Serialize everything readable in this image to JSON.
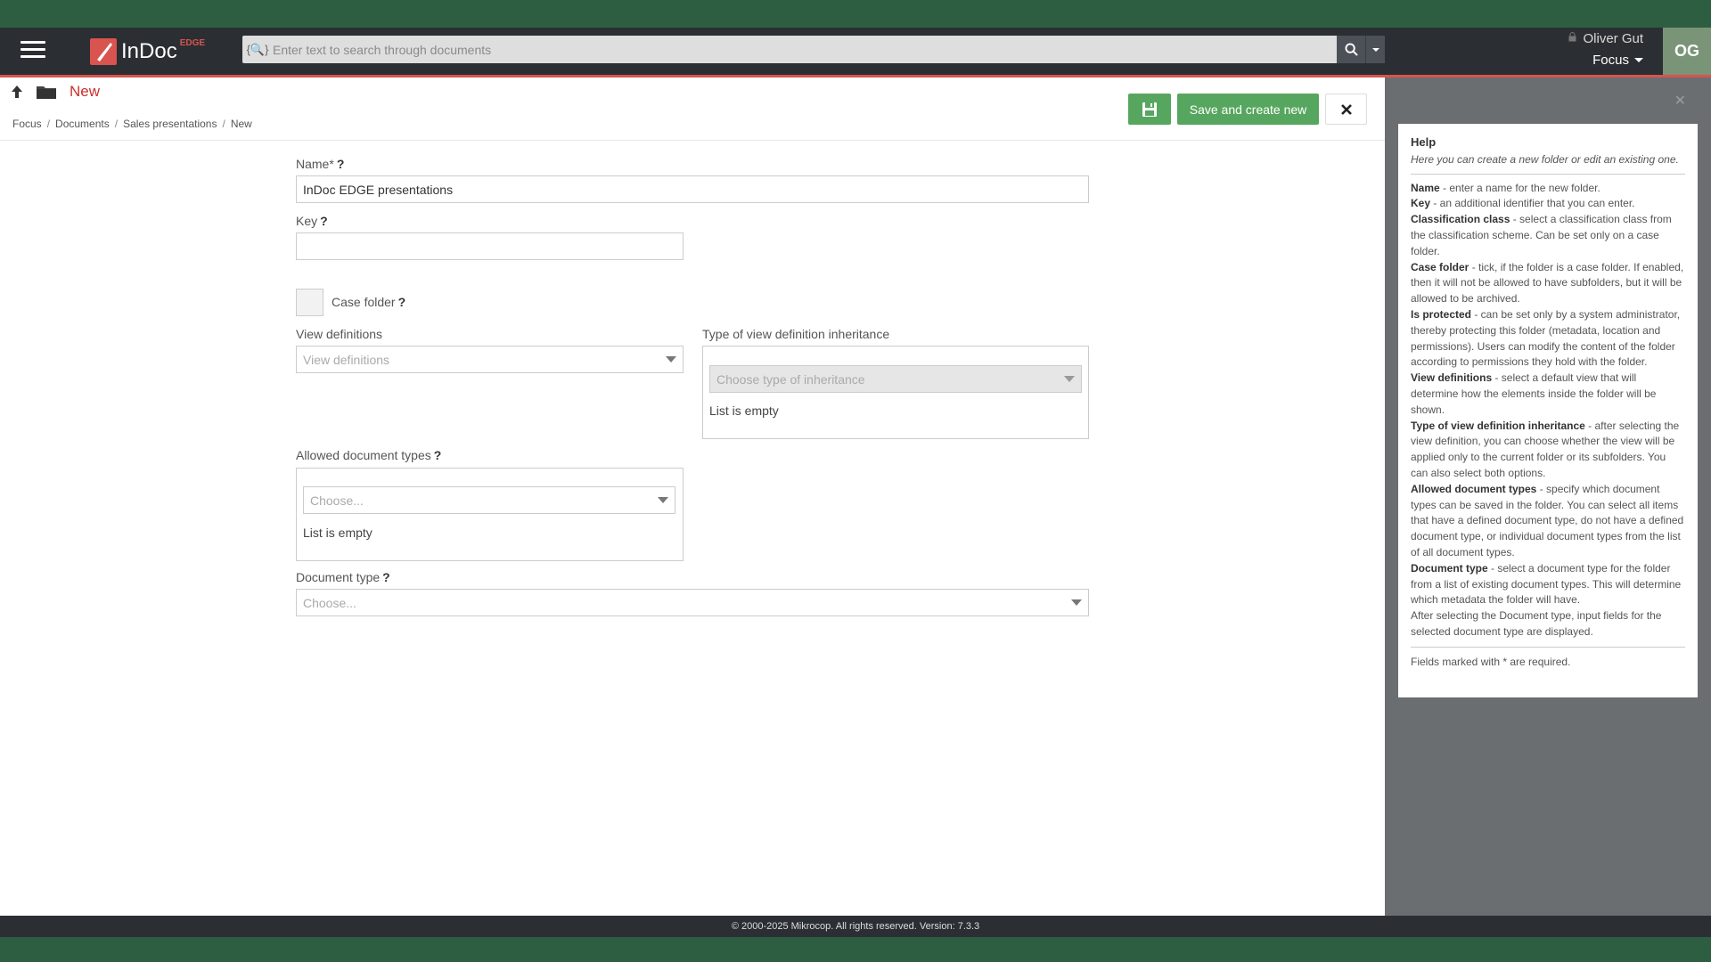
{
  "app": {
    "name": "InDoc",
    "edition": "EDGE"
  },
  "search": {
    "placeholder": "Enter text to search through documents"
  },
  "user": {
    "name": "Oliver Gut",
    "initials": "OG",
    "context": "Focus"
  },
  "page": {
    "title": "New"
  },
  "breadcrumb": [
    "Focus",
    "Documents",
    "Sales presentations",
    "New"
  ],
  "toolbar": {
    "save_new_label": "Save and create new"
  },
  "form": {
    "name_label": "Name",
    "name_required": "*",
    "name_value": "InDoc EDGE presentations",
    "key_label": "Key",
    "key_value": "",
    "case_folder_label": "Case folder",
    "view_definitions_label": "View definitions",
    "view_definitions_placeholder": "View definitions",
    "inheritance_label": "Type of view definition inheritance",
    "inheritance_placeholder": "Choose type of inheritance",
    "inheritance_empty": "List is empty",
    "allowed_types_label": "Allowed document types",
    "allowed_types_placeholder": "Choose...",
    "allowed_types_empty": "List is empty",
    "doc_type_label": "Document type",
    "doc_type_placeholder": "Choose...",
    "help_marker": "?"
  },
  "help": {
    "title": "Help",
    "intro": "Here you can create a new folder or edit an existing one.",
    "items": [
      {
        "term": "Name",
        "text": " - enter a name for the new folder."
      },
      {
        "term": "Key",
        "text": " - an additional identifier that you can enter."
      },
      {
        "term": "Classification class",
        "text": " - select a classification class from the classification scheme. Can be set only on a case folder."
      },
      {
        "term": "Case folder",
        "text": " - tick, if the folder is a case folder. If enabled, then it will not be allowed to have subfolders, but it will be allowed to be archived."
      },
      {
        "term": "Is protected",
        "text": " - can be set only by a system administrator, thereby protecting this folder (metadata, location and permissions). Users can modify the content of the folder according to permissions they hold with the folder."
      },
      {
        "term": "View definitions",
        "text": " - select a default view that will determine how the elements inside the folder will be shown."
      },
      {
        "term": "Type of view definition inheritance",
        "text": " - after selecting the view definition, you can choose whether the view will be applied only to the current folder or its subfolders. You can also select both options."
      },
      {
        "term": "Allowed document types",
        "text": " - specify which document types can be saved in the folder. You can select all items that have a defined document type, do not have a defined document type, or individual document types from the list of all document types."
      },
      {
        "term": "Document type",
        "text": " - select a document type for the folder from a list of existing document types. This will determine which metadata the folder will have."
      }
    ],
    "after": "After selecting the Document type, input fields for the selected document type are displayed.",
    "footnote": "Fields marked with * are required."
  },
  "footer": {
    "text": "© 2000-2025 Mikrocop. All rights reserved. Version: 7.3.3"
  },
  "colors": {
    "accent_red": "#d9534f",
    "save_green": "#57a65f",
    "topbar": "#2b2f33"
  }
}
